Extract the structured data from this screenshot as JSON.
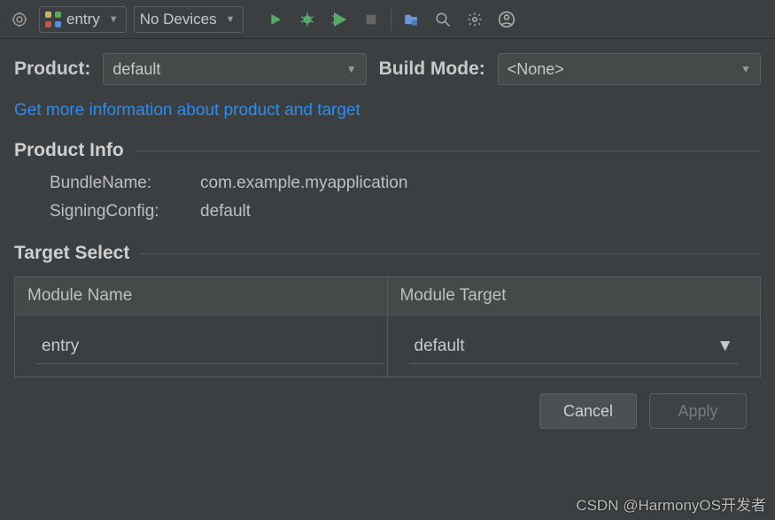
{
  "toolbar": {
    "config_label": "entry",
    "device_label": "No Devices"
  },
  "product": {
    "label": "Product:",
    "value": "default"
  },
  "build_mode": {
    "label": "Build Mode:",
    "value": "<None>"
  },
  "link_text": "Get more information about product and target",
  "product_info": {
    "title": "Product Info",
    "bundle_name_label": "BundleName:",
    "bundle_name_value": "com.example.myapplication",
    "signing_config_label": "SigningConfig:",
    "signing_config_value": "default"
  },
  "target_select": {
    "title": "Target Select",
    "col_module_name": "Module Name",
    "col_module_target": "Module Target",
    "rows": [
      {
        "module_name": "entry",
        "module_target": "default"
      }
    ]
  },
  "buttons": {
    "cancel": "Cancel",
    "apply": "Apply"
  },
  "watermark": "CSDN @HarmonyOS开发者"
}
